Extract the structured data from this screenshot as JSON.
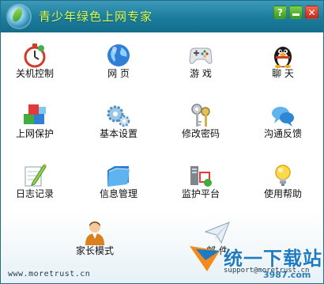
{
  "window": {
    "title": "青少年绿色上网专家",
    "controls": {
      "help": "?",
      "close": "✕"
    }
  },
  "tiles": [
    {
      "label": "关机控制",
      "icon": "stopwatch-icon"
    },
    {
      "label": "网 页",
      "icon": "globe-icon"
    },
    {
      "label": "游 戏",
      "icon": "gamepad-icon"
    },
    {
      "label": "聊 天",
      "icon": "penguin-icon"
    },
    {
      "label": "上网保护",
      "icon": "blocks-icon"
    },
    {
      "label": "基本设置",
      "icon": "gears-icon"
    },
    {
      "label": "修改密码",
      "icon": "keys-icon"
    },
    {
      "label": "沟通反馈",
      "icon": "chat-bubbles-icon"
    },
    {
      "label": "日志记录",
      "icon": "notepad-pencil-icon"
    },
    {
      "label": "信息管理",
      "icon": "folder-icon"
    },
    {
      "label": "监护平台",
      "icon": "monitor-icon"
    },
    {
      "label": "使用帮助",
      "icon": "lightbulb-icon"
    },
    {
      "label": "家长模式",
      "icon": "parent-icon"
    },
    {
      "label": "邮 件",
      "icon": "paper-plane-icon"
    }
  ],
  "footer": {
    "website": "www.moretrust.cn",
    "email": "support@moretrust.cn"
  },
  "watermark": {
    "text": "统一下载站",
    "sub": "3987.com"
  }
}
